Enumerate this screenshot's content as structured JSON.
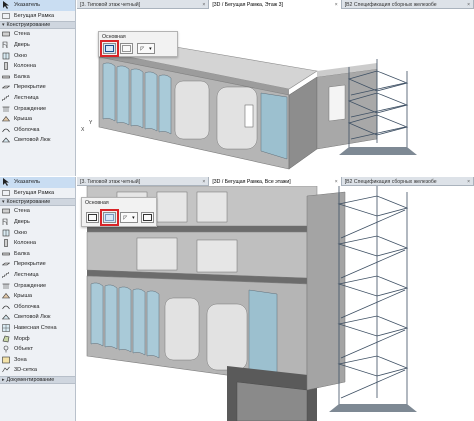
{
  "top": {
    "tools": [
      {
        "label": "Указатель",
        "icon": "pointer-icon",
        "selected": true
      },
      {
        "label": "Бегущая Рамка",
        "icon": "marquee-icon",
        "selected": false
      }
    ],
    "group_header": "Конструирование",
    "design_tools": [
      {
        "label": "Стена",
        "icon": "wall-icon"
      },
      {
        "label": "Дверь",
        "icon": "door-icon"
      },
      {
        "label": "Окно",
        "icon": "window-icon"
      },
      {
        "label": "Колонна",
        "icon": "column-icon"
      },
      {
        "label": "Балка",
        "icon": "beam-icon"
      },
      {
        "label": "Перекрытие",
        "icon": "slab-icon"
      },
      {
        "label": "Лестница",
        "icon": "stair-icon"
      },
      {
        "label": "Ограждение",
        "icon": "railing-icon"
      },
      {
        "label": "Крыша",
        "icon": "roof-icon"
      },
      {
        "label": "Оболочка",
        "icon": "shell-icon"
      },
      {
        "label": "Световой Люк",
        "icon": "skylight-icon"
      }
    ],
    "tabs": [
      {
        "label": "[3. Типовой этаж четный]",
        "active": false
      },
      {
        "label": "[3D / Бегущая Рамка, Этаж 3]",
        "active": true
      },
      {
        "label": "[В2 Спецификация сборных железобе",
        "active": false
      }
    ],
    "method_title": "Основная"
  },
  "bottom": {
    "tools": [
      {
        "label": "Указатель",
        "icon": "pointer-icon",
        "selected": true
      },
      {
        "label": "Бегущая Рамка",
        "icon": "marquee-icon",
        "selected": false
      }
    ],
    "group_header": "Конструирование",
    "design_tools": [
      {
        "label": "Стена",
        "icon": "wall-icon"
      },
      {
        "label": "Дверь",
        "icon": "door-icon"
      },
      {
        "label": "Окно",
        "icon": "window-icon"
      },
      {
        "label": "Колонна",
        "icon": "column-icon"
      },
      {
        "label": "Балка",
        "icon": "beam-icon"
      },
      {
        "label": "Перекрытие",
        "icon": "slab-icon"
      },
      {
        "label": "Лестница",
        "icon": "stair-icon"
      },
      {
        "label": "Ограждение",
        "icon": "railing-icon"
      },
      {
        "label": "Крыша",
        "icon": "roof-icon"
      },
      {
        "label": "Оболочка",
        "icon": "shell-icon"
      },
      {
        "label": "Световой Люк",
        "icon": "skylight-icon"
      },
      {
        "label": "Навесная Стена",
        "icon": "curtain-wall-icon"
      },
      {
        "label": "Морф",
        "icon": "morph-icon"
      },
      {
        "label": "Объект",
        "icon": "object-icon"
      },
      {
        "label": "Зона",
        "icon": "zone-icon"
      },
      {
        "label": "3D-сетка",
        "icon": "mesh-icon"
      }
    ],
    "group_header_2": "Документирование",
    "tabs": [
      {
        "label": "[3. Типовой этаж четный]",
        "active": false
      },
      {
        "label": "[3D / Бегущая Рамка, Все этажи]",
        "active": true
      },
      {
        "label": "[В2 Спецификация сборных железобе",
        "active": false
      }
    ],
    "method_title": "Основная"
  },
  "axis_x": "X",
  "axis_y": "Y",
  "colors": {
    "highlight": "#d82428",
    "glass": "#a9cad8",
    "concrete": "#b9b9b9",
    "steel": "#3d4f63"
  }
}
